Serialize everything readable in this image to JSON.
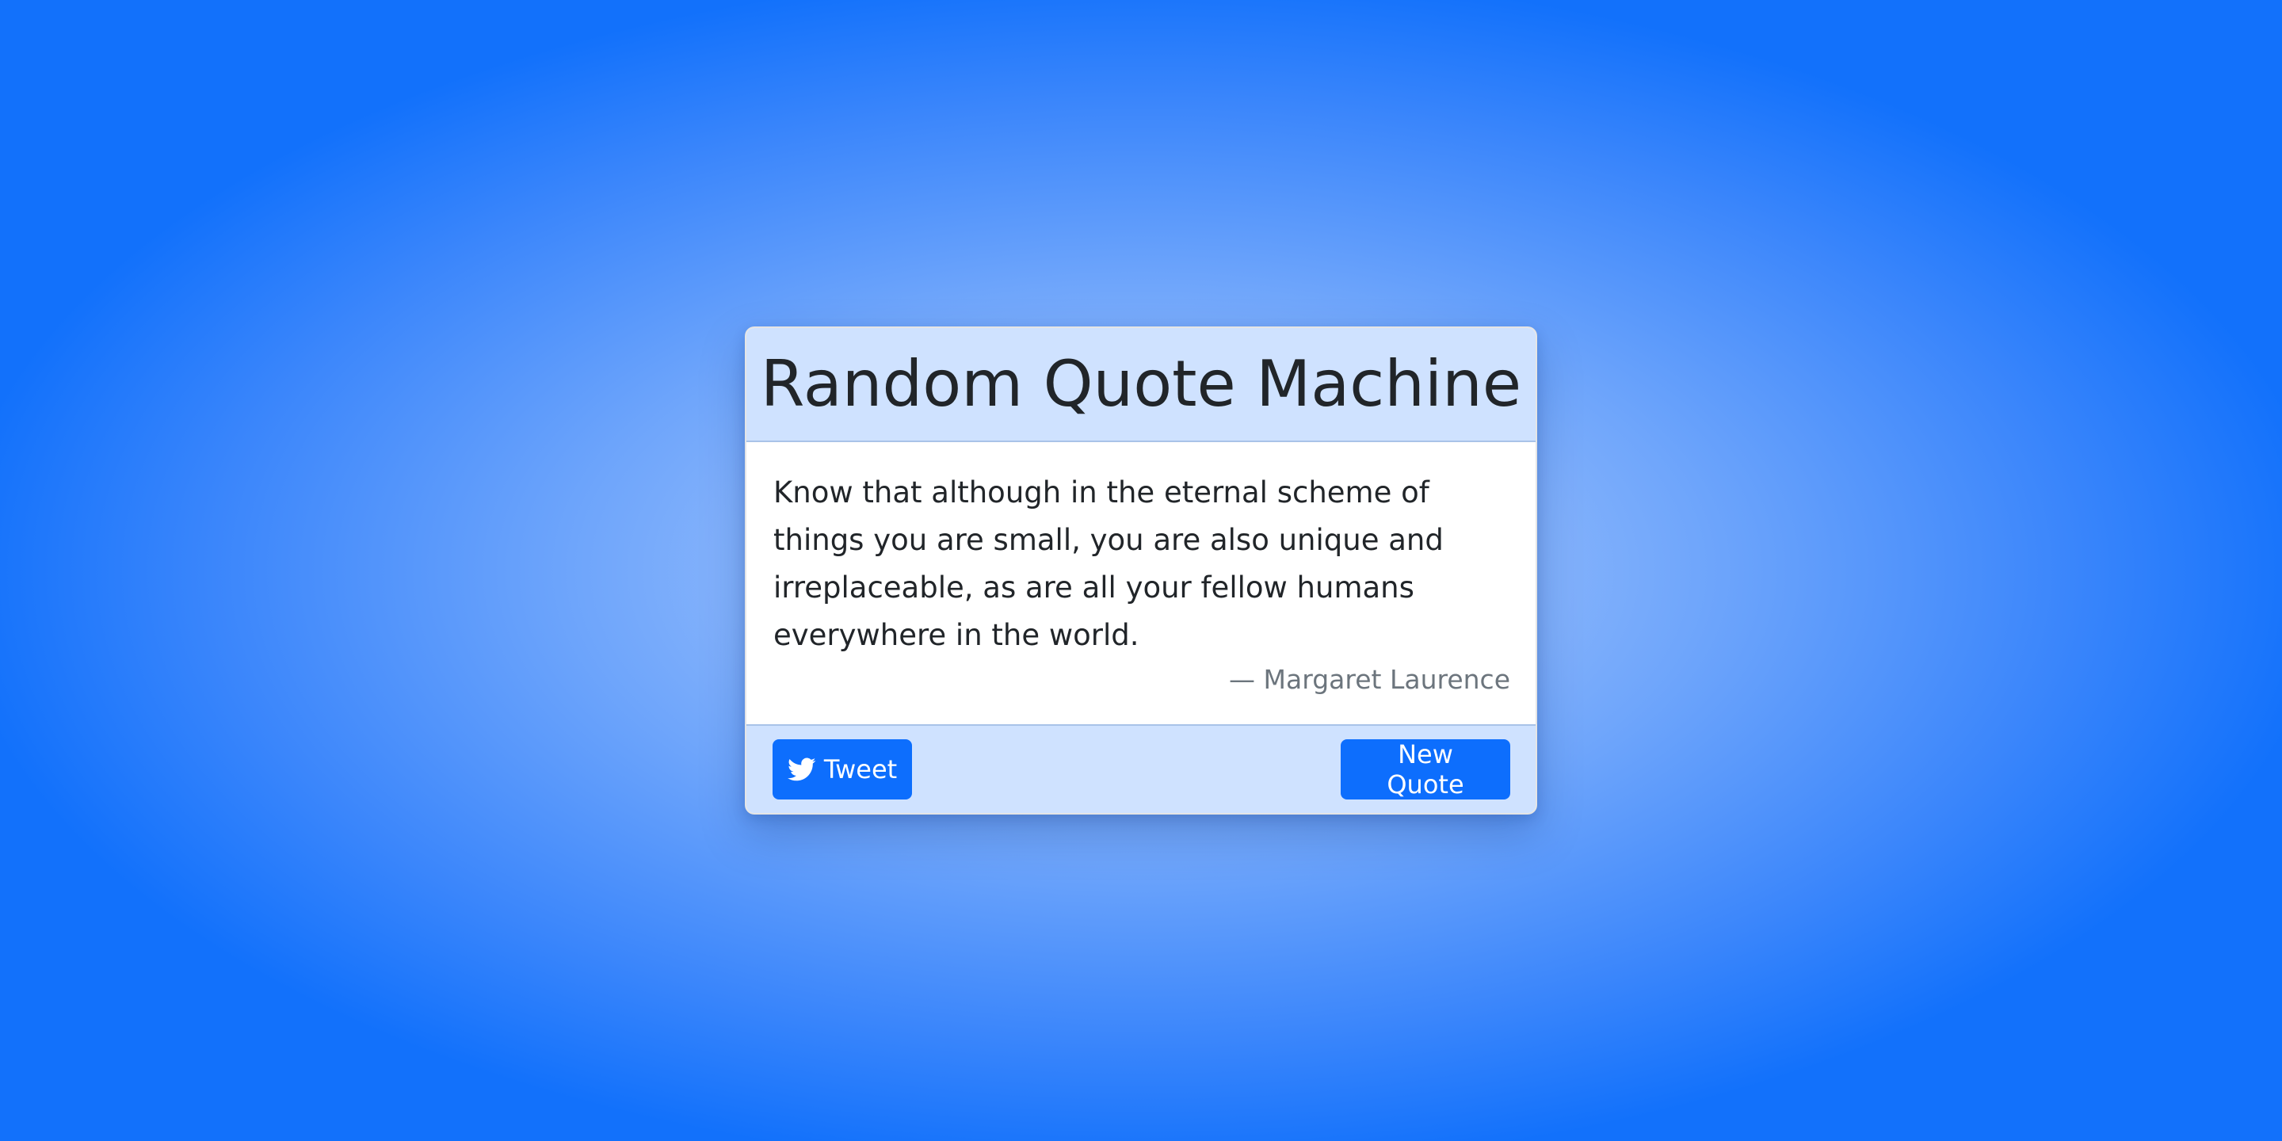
{
  "app": {
    "title": "Random Quote Machine"
  },
  "quote": {
    "text": "Know that although in the eternal scheme of things you are small, you are also unique and irreplaceable, as are all your fellow humans everywhere in the world.",
    "author": "— Margaret Laurence"
  },
  "actions": {
    "tweet_label": "Tweet",
    "tweet_icon": "twitter-bird-icon",
    "new_quote_label": "New Quote"
  },
  "colors": {
    "accent": "#0d6efd",
    "panel": "#cfe2ff",
    "background_center": "#b3cffd",
    "background_edge": "#1271fb"
  }
}
